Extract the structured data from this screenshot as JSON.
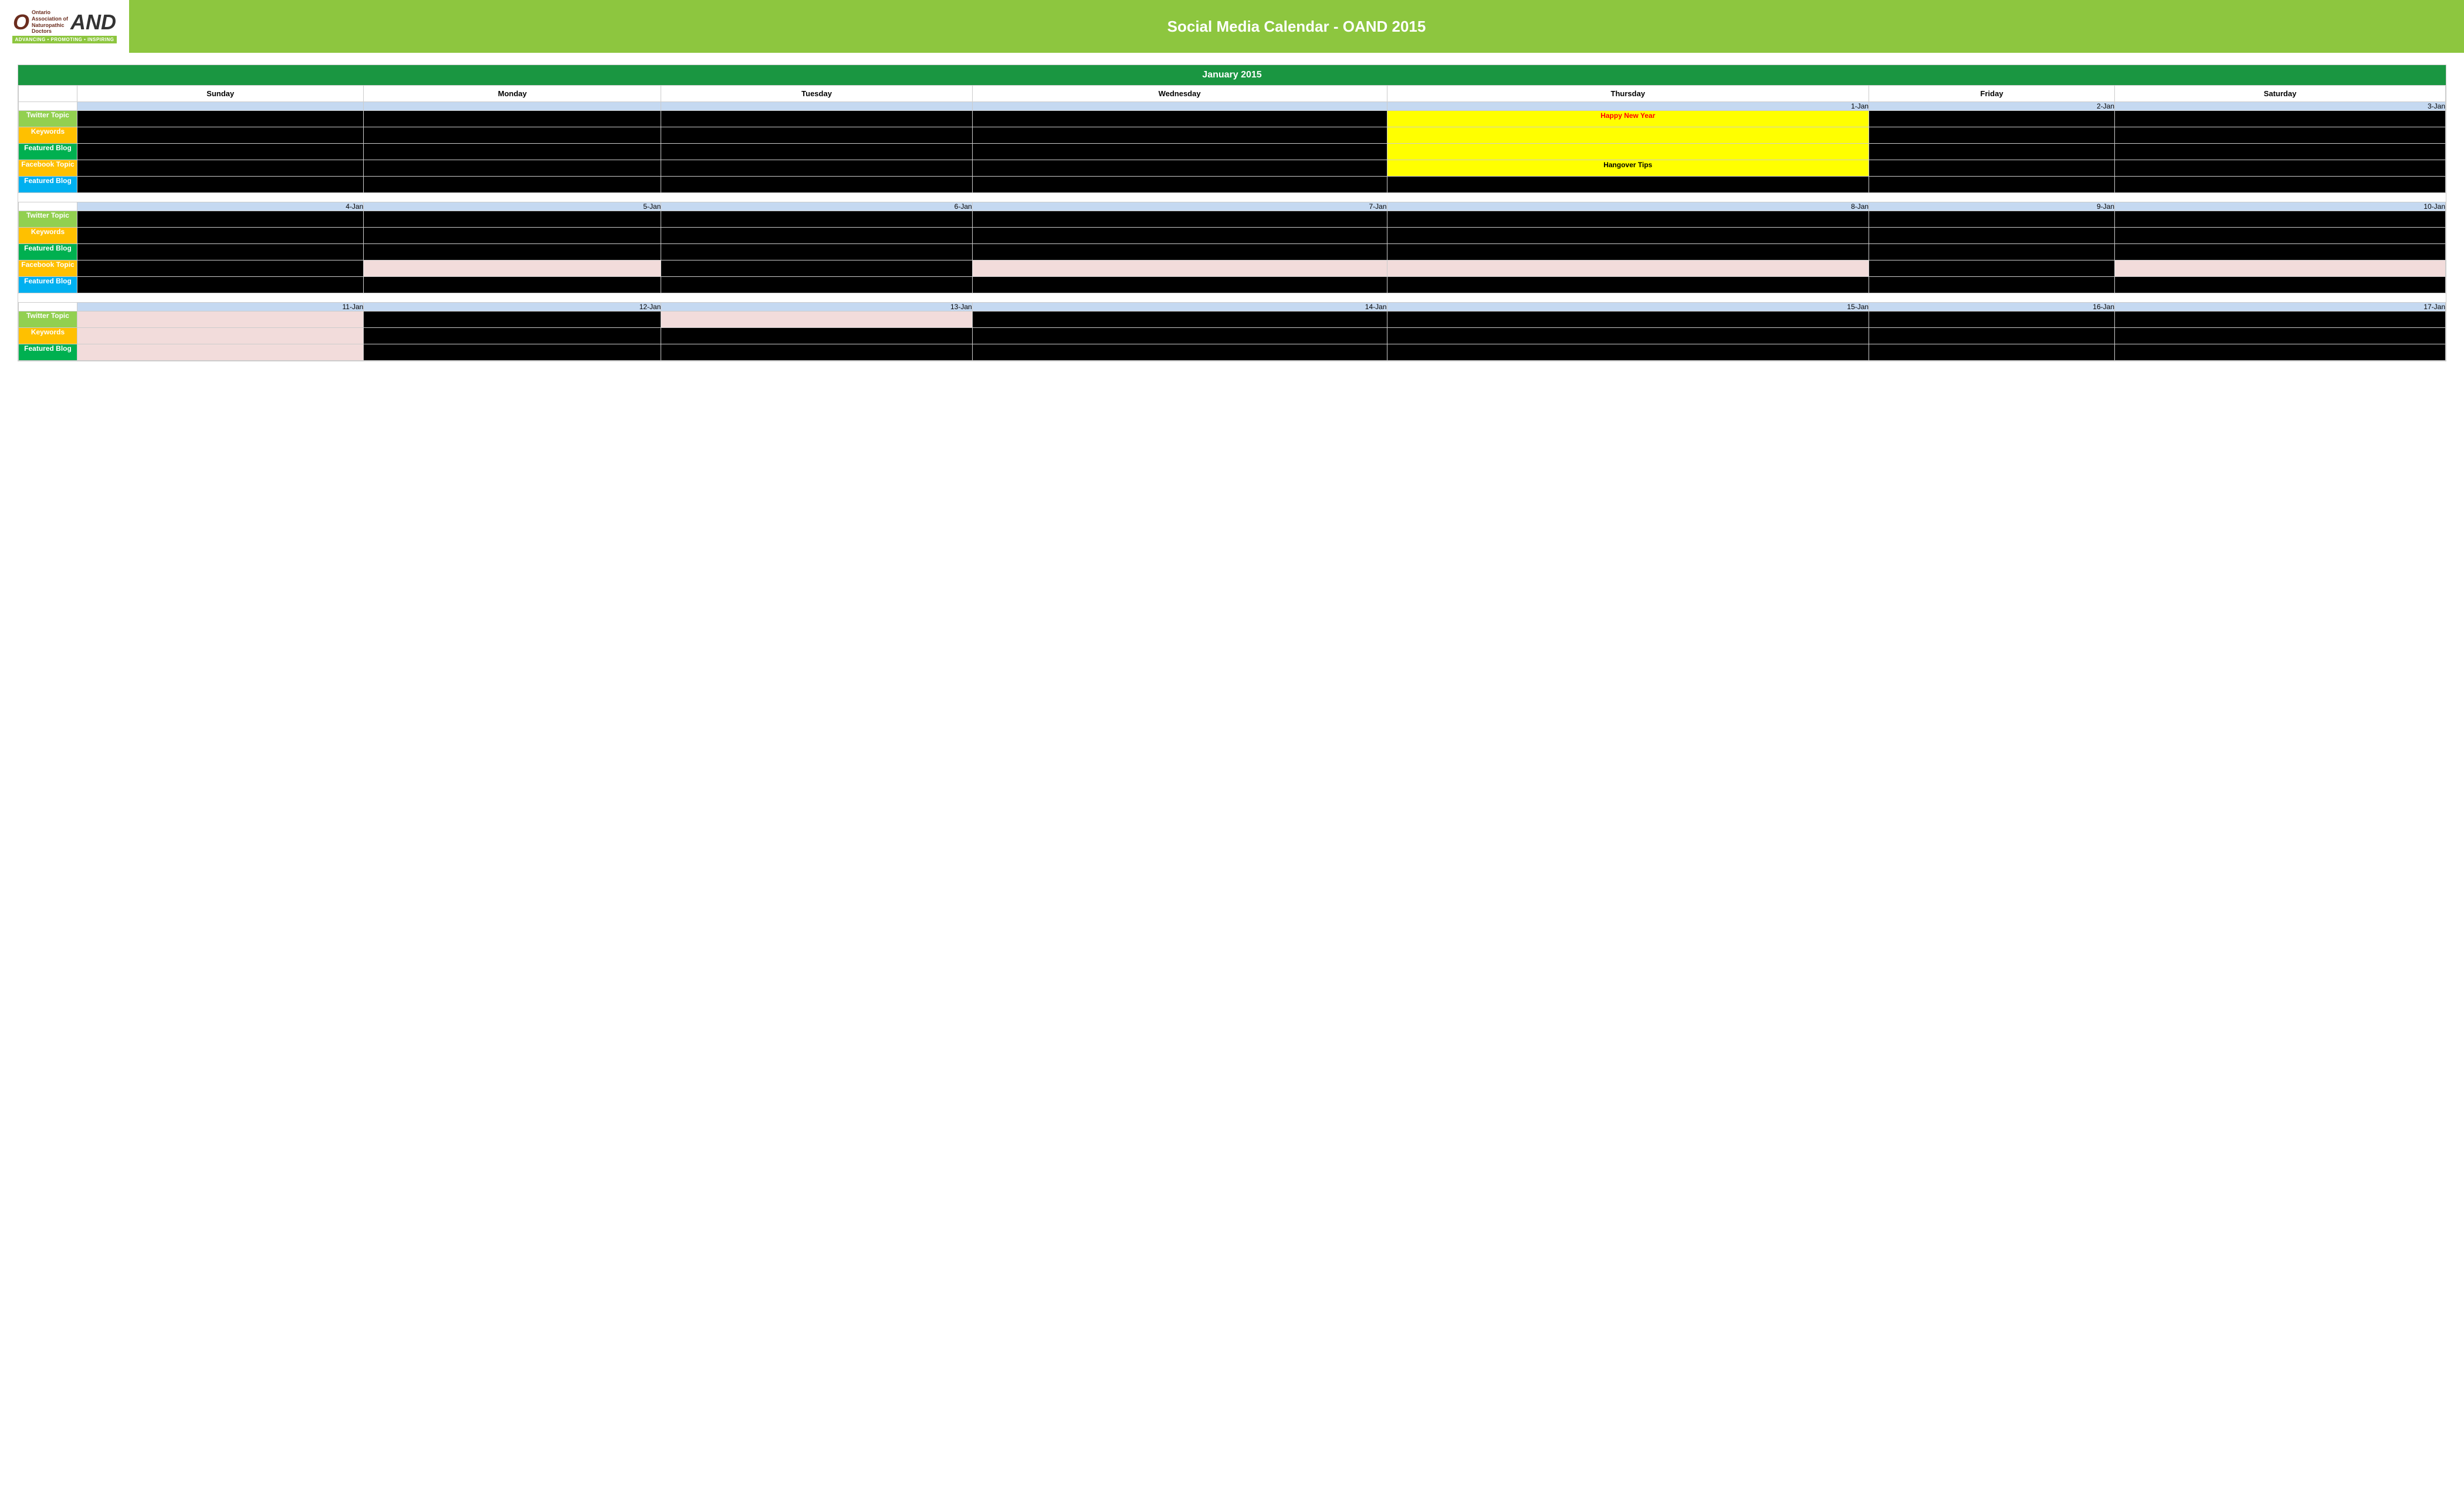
{
  "header": {
    "title": "Social Media Calendar - OAND 2015",
    "logo_text": "OAND",
    "logo_subtitle_line1": "Ontario",
    "logo_subtitle_line2": "Association of",
    "logo_subtitle_line3": "Naturopathic",
    "logo_subtitle_line4": "Doctors",
    "tagline": "ADVANCING • PROMOTING • INSPIRING"
  },
  "calendar": {
    "month": "January 2015",
    "days_of_week": [
      "Sunday",
      "Monday",
      "Tuesday",
      "Wednesday",
      "Thursday",
      "Friday",
      "Saturday"
    ],
    "row_labels": {
      "twitter": "Twitter Topic",
      "keywords": "Keywords",
      "featured_blog_green": "Featured Blog",
      "facebook": "Facebook Topic",
      "featured_blog_blue": "Featured Blog"
    },
    "weeks": [
      {
        "id": "week1",
        "dates": [
          "",
          "",
          "",
          "",
          "1-Jan",
          "2-Jan",
          "3-Jan"
        ],
        "rows": {
          "twitter": [
            "",
            "",
            "",
            "",
            "yellow_text:Happy New Year",
            "",
            ""
          ],
          "keywords": [
            "",
            "",
            "",
            "",
            "yellow_empty",
            "",
            ""
          ],
          "featured": [
            "",
            "",
            "",
            "",
            "yellow_empty",
            "",
            ""
          ],
          "facebook": [
            "",
            "",
            "",
            "",
            "yellow_plain:Hangover Tips",
            "",
            ""
          ],
          "featured2": [
            "",
            "",
            "",
            "",
            "",
            "",
            ""
          ]
        }
      },
      {
        "id": "week2",
        "dates": [
          "4-Jan",
          "5-Jan",
          "6-Jan",
          "7-Jan",
          "8-Jan",
          "9-Jan",
          "10-Jan"
        ],
        "rows": {
          "twitter": [
            "",
            "",
            "",
            "",
            "",
            "",
            ""
          ],
          "keywords": [
            "",
            "",
            "",
            "",
            "",
            "",
            ""
          ],
          "featured": [
            "",
            "",
            "",
            "",
            "",
            "",
            ""
          ],
          "facebook": [
            "",
            "pink:",
            "",
            "pink:",
            "pink:",
            "",
            "pink:"
          ],
          "featured2": [
            "",
            "",
            "",
            "",
            "",
            "",
            ""
          ]
        }
      },
      {
        "id": "week3",
        "dates": [
          "11-Jan",
          "12-Jan",
          "13-Jan",
          "14-Jan",
          "15-Jan",
          "16-Jan",
          "17-Jan"
        ],
        "rows": {
          "twitter": [
            "pink:",
            "",
            "pink:",
            "",
            "",
            "",
            ""
          ],
          "keywords": [
            "pink:",
            "",
            "",
            "",
            "",
            "",
            ""
          ],
          "featured": [
            "pink:",
            "",
            "",
            "",
            "",
            "",
            ""
          ],
          "facebook": [
            "",
            "",
            "",
            "",
            "",
            "",
            ""
          ],
          "featured2": [
            "",
            "",
            "",
            "",
            "",
            "",
            ""
          ]
        }
      }
    ]
  }
}
